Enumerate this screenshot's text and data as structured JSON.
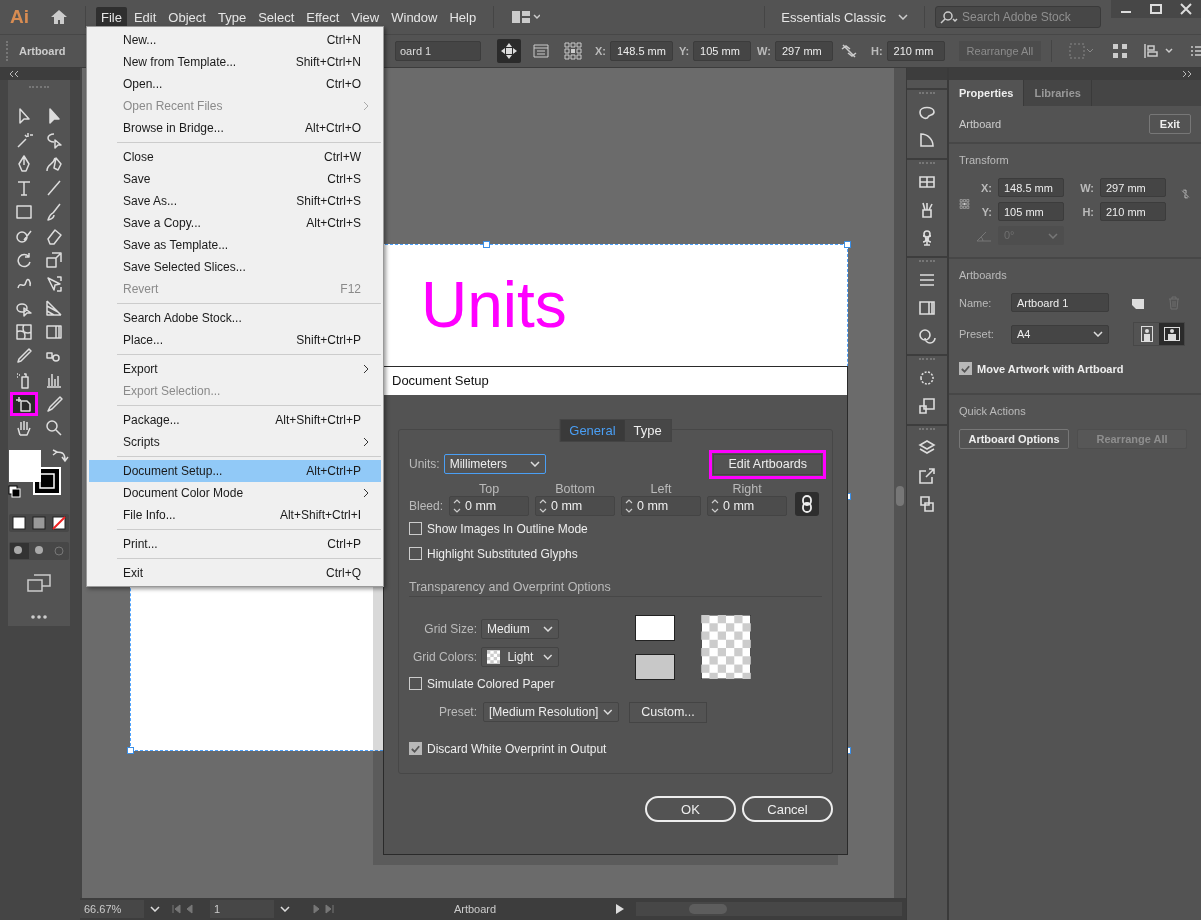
{
  "app": {
    "logo": "Ai"
  },
  "menubar": [
    {
      "label": "File",
      "selected": true
    },
    {
      "label": "Edit",
      "selected": false
    },
    {
      "label": "Object",
      "selected": false
    },
    {
      "label": "Type",
      "selected": false
    },
    {
      "label": "Select",
      "selected": false
    },
    {
      "label": "Effect",
      "selected": false
    },
    {
      "label": "View",
      "selected": false
    },
    {
      "label": "Window",
      "selected": false
    },
    {
      "label": "Help",
      "selected": false
    }
  ],
  "workspace": {
    "label": "Essentials Classic"
  },
  "search": {
    "placeholder": "Search Adobe Stock"
  },
  "control_bar": {
    "label": "Artboard",
    "name_field": "oard 1",
    "fields": [
      {
        "label": "X:",
        "value": "148.5 mm"
      },
      {
        "label": "Y:",
        "value": "105 mm"
      },
      {
        "label": "W:",
        "value": "297 mm"
      },
      {
        "label": "H:",
        "value": "210 mm"
      }
    ],
    "rearrange": {
      "label": "Rearrange All",
      "disabled": true
    }
  },
  "tools": [
    {
      "kind": "selection",
      "highlighted": false
    },
    {
      "kind": "direct",
      "highlighted": false
    },
    {
      "kind": "wand",
      "highlighted": false
    },
    {
      "kind": "lasso",
      "highlighted": false
    },
    {
      "kind": "pen",
      "highlighted": false
    },
    {
      "kind": "curvature",
      "highlighted": false
    },
    {
      "kind": "type",
      "highlighted": false
    },
    {
      "kind": "line",
      "highlighted": false
    },
    {
      "kind": "rectangle",
      "highlighted": false
    },
    {
      "kind": "brush",
      "highlighted": false
    },
    {
      "kind": "shaper",
      "highlighted": false
    },
    {
      "kind": "eraser",
      "highlighted": false
    },
    {
      "kind": "rotate",
      "highlighted": false
    },
    {
      "kind": "scale",
      "highlighted": false
    },
    {
      "kind": "warp",
      "highlighted": false
    },
    {
      "kind": "transform",
      "highlighted": false
    },
    {
      "kind": "builder",
      "highlighted": false
    },
    {
      "kind": "perspective",
      "highlighted": false
    },
    {
      "kind": "mesh",
      "highlighted": false
    },
    {
      "kind": "gradient",
      "highlighted": false
    },
    {
      "kind": "eyedropper",
      "highlighted": false
    },
    {
      "kind": "blend",
      "highlighted": false
    },
    {
      "kind": "sprayer",
      "highlighted": false
    },
    {
      "kind": "graph",
      "highlighted": false
    },
    {
      "kind": "artboard",
      "highlighted": true
    },
    {
      "kind": "slice",
      "highlighted": false
    },
    {
      "kind": "hand",
      "highlighted": false
    },
    {
      "kind": "zoom",
      "highlighted": false
    }
  ],
  "artboard": {
    "text": "Units"
  },
  "file_menu": {
    "groups": [
      {
        "items": [
          {
            "label": "New...",
            "shortcut": "Ctrl+N",
            "disabled": false,
            "submenu": false,
            "selected": false
          },
          {
            "label": "New from Template...",
            "shortcut": "Shift+Ctrl+N",
            "disabled": false,
            "submenu": false,
            "selected": false
          },
          {
            "label": "Open...",
            "shortcut": "Ctrl+O",
            "disabled": false,
            "submenu": false,
            "selected": false
          },
          {
            "label": "Open Recent Files",
            "disabled": true,
            "submenu": true,
            "selected": false
          },
          {
            "label": "Browse in Bridge...",
            "shortcut": "Alt+Ctrl+O",
            "disabled": false,
            "submenu": false,
            "selected": false
          }
        ]
      },
      {
        "items": [
          {
            "label": "Close",
            "shortcut": "Ctrl+W",
            "disabled": false,
            "submenu": false,
            "selected": false
          },
          {
            "label": "Save",
            "shortcut": "Ctrl+S",
            "disabled": false,
            "submenu": false,
            "selected": false
          },
          {
            "label": "Save As...",
            "shortcut": "Shift+Ctrl+S",
            "disabled": false,
            "submenu": false,
            "selected": false
          },
          {
            "label": "Save a Copy...",
            "shortcut": "Alt+Ctrl+S",
            "disabled": false,
            "submenu": false,
            "selected": false
          },
          {
            "label": "Save as Template...",
            "disabled": false,
            "submenu": false,
            "selected": false
          },
          {
            "label": "Save Selected Slices...",
            "disabled": false,
            "submenu": false,
            "selected": false
          },
          {
            "label": "Revert",
            "shortcut": "F12",
            "disabled": true,
            "submenu": false,
            "selected": false
          }
        ]
      },
      {
        "items": [
          {
            "label": "Search Adobe Stock...",
            "disabled": false,
            "submenu": false,
            "selected": false
          },
          {
            "label": "Place...",
            "shortcut": "Shift+Ctrl+P",
            "disabled": false,
            "submenu": false,
            "selected": false
          }
        ]
      },
      {
        "items": [
          {
            "label": "Export",
            "disabled": false,
            "submenu": true,
            "selected": false
          },
          {
            "label": "Export Selection...",
            "disabled": true,
            "submenu": false,
            "selected": false
          }
        ]
      },
      {
        "items": [
          {
            "label": "Package...",
            "shortcut": "Alt+Shift+Ctrl+P",
            "disabled": false,
            "submenu": false,
            "selected": false
          },
          {
            "label": "Scripts",
            "disabled": false,
            "submenu": true,
            "selected": false
          }
        ]
      },
      {
        "items": [
          {
            "label": "Document Setup...",
            "shortcut": "Alt+Ctrl+P",
            "disabled": false,
            "submenu": false,
            "selected": true
          },
          {
            "label": "Document Color Mode",
            "disabled": false,
            "submenu": true,
            "selected": false
          },
          {
            "label": "File Info...",
            "shortcut": "Alt+Shift+Ctrl+I",
            "disabled": false,
            "submenu": false,
            "selected": false
          }
        ]
      },
      {
        "items": [
          {
            "label": "Print...",
            "shortcut": "Ctrl+P",
            "disabled": false,
            "submenu": false,
            "selected": false
          }
        ]
      },
      {
        "items": [
          {
            "label": "Exit",
            "shortcut": "Ctrl+Q",
            "disabled": false,
            "submenu": false,
            "selected": false
          }
        ]
      }
    ]
  },
  "dialog": {
    "title": "Document Setup",
    "tabs": [
      {
        "label": "General",
        "selected": true
      },
      {
        "label": "Type",
        "selected": false
      }
    ],
    "units": {
      "label": "Units:",
      "value": "Millimeters"
    },
    "edit_artboards": {
      "label": "Edit Artboards",
      "highlighted": true
    },
    "bleed": {
      "label": "Bleed:",
      "fields": [
        {
          "heading": "Top",
          "value": "0 mm"
        },
        {
          "heading": "Bottom",
          "value": "0 mm"
        },
        {
          "heading": "Left",
          "value": "0 mm"
        },
        {
          "heading": "Right",
          "value": "0 mm"
        }
      ]
    },
    "options": [
      {
        "label": "Show Images In Outline Mode",
        "checked": false
      },
      {
        "label": "Highlight Substituted Glyphs",
        "checked": false
      }
    ],
    "transparency": {
      "title": "Transparency and Overprint Options",
      "grid_size": {
        "label": "Grid Size:",
        "value": "Medium"
      },
      "grid_colors": {
        "label": "Grid Colors:",
        "value": "Light"
      },
      "simulate_paper": {
        "label": "Simulate Colored Paper",
        "checked": false
      },
      "preset": {
        "label": "Preset:",
        "value": "[Medium Resolution]"
      },
      "custom_button": "Custom...",
      "discard_white": {
        "label": "Discard White Overprint in Output",
        "checked": true
      }
    },
    "buttons": [
      {
        "label": "OK"
      },
      {
        "label": "Cancel"
      }
    ]
  },
  "properties": {
    "tabs": [
      {
        "label": "Properties",
        "selected": true
      },
      {
        "label": "Libraries",
        "selected": false
      }
    ],
    "context": "Artboard",
    "exit_button": "Exit",
    "transform": {
      "title": "Transform",
      "fields": [
        {
          "label": "X:",
          "value": "148.5 mm"
        },
        {
          "label": "W:",
          "value": "297 mm"
        },
        {
          "label": "Y:",
          "value": "105 mm"
        },
        {
          "label": "H:",
          "value": "210 mm"
        }
      ],
      "angle": {
        "value": "0°",
        "disabled": true
      }
    },
    "artboards": {
      "title": "Artboards",
      "name": {
        "label": "Name:",
        "value": "Artboard 1"
      },
      "preset": {
        "label": "Preset:",
        "value": "A4"
      },
      "orientation": [
        {
          "kind": "portrait",
          "selected": false
        },
        {
          "kind": "landscape",
          "selected": true
        }
      ],
      "move_artwork": {
        "label": "Move Artwork with Artboard",
        "checked": true
      }
    },
    "quick_actions": {
      "title": "Quick Actions",
      "buttons": [
        {
          "label": "Artboard Options",
          "disabled": false
        },
        {
          "label": "Rearrange All",
          "disabled": true
        }
      ]
    }
  },
  "status_bar": {
    "zoom": "66.67%",
    "artboard_number": "1",
    "label": "Artboard"
  }
}
